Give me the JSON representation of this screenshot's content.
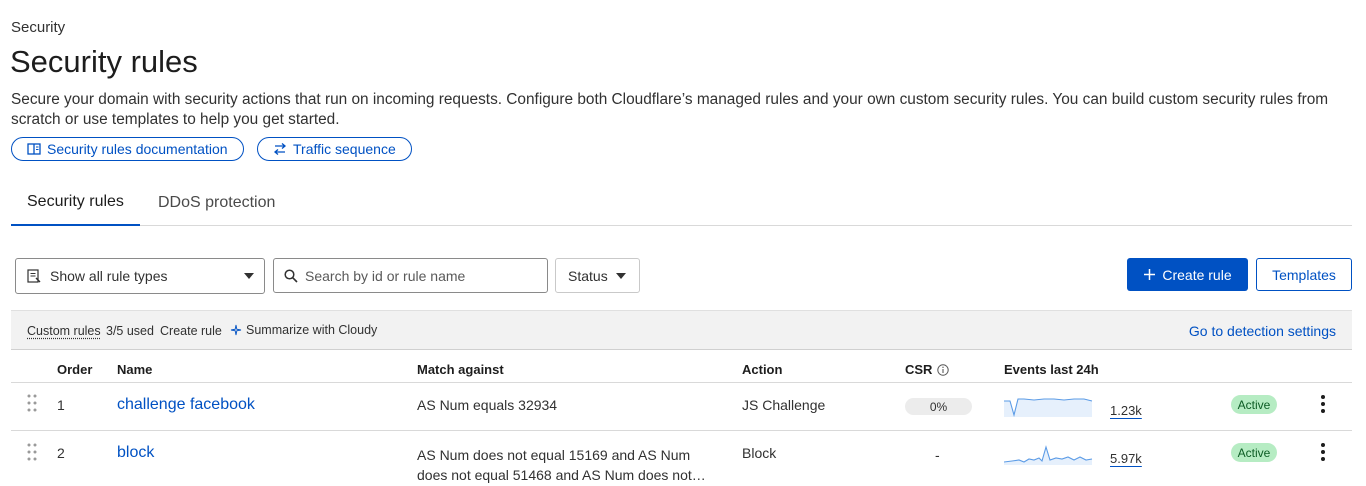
{
  "breadcrumb": "Security",
  "page_title": "Security rules",
  "description": "Secure your domain with security actions that run on incoming requests. Configure both Cloudflare’s managed rules and your own custom security rules. You can build custom security rules from scratch or use templates to help you get started.",
  "links": {
    "docs": "Security rules documentation",
    "traffic": "Traffic sequence"
  },
  "tabs": [
    {
      "label": "Security rules",
      "active": true
    },
    {
      "label": "DDoS protection",
      "active": false
    }
  ],
  "filters": {
    "rule_type": "Show all rule types",
    "search_placeholder": "Search by id or rule name",
    "status": "Status"
  },
  "actions": {
    "create_rule": "Create rule",
    "templates": "Templates"
  },
  "infobar": {
    "custom_rules": "Custom rules",
    "usage": "3/5 used",
    "create_rule": "Create rule",
    "summarize": "Summarize with Cloudy",
    "detection": "Go to detection settings"
  },
  "table": {
    "headers": {
      "order": "Order",
      "name": "Name",
      "match": "Match against",
      "action": "Action",
      "csr": "CSR",
      "events": "Events last 24h"
    },
    "rows": [
      {
        "order": "1",
        "name": "challenge facebook",
        "match_line1": "AS Num equals 32934",
        "match_line2": "",
        "action": "JS Challenge",
        "csr": "0%",
        "events": "1.23k",
        "status": "Active"
      },
      {
        "order": "2",
        "name": "block",
        "match_line1": "AS Num does not equal 15169 and AS Num",
        "match_line2": "does not equal 51468 and AS Num does not…",
        "action": "Block",
        "csr": "-",
        "events": "5.97k",
        "status": "Active"
      }
    ]
  },
  "colors": {
    "accent": "#0051c3",
    "badge_bg": "#b6ecc3",
    "sparkline": "#5b9be6"
  }
}
